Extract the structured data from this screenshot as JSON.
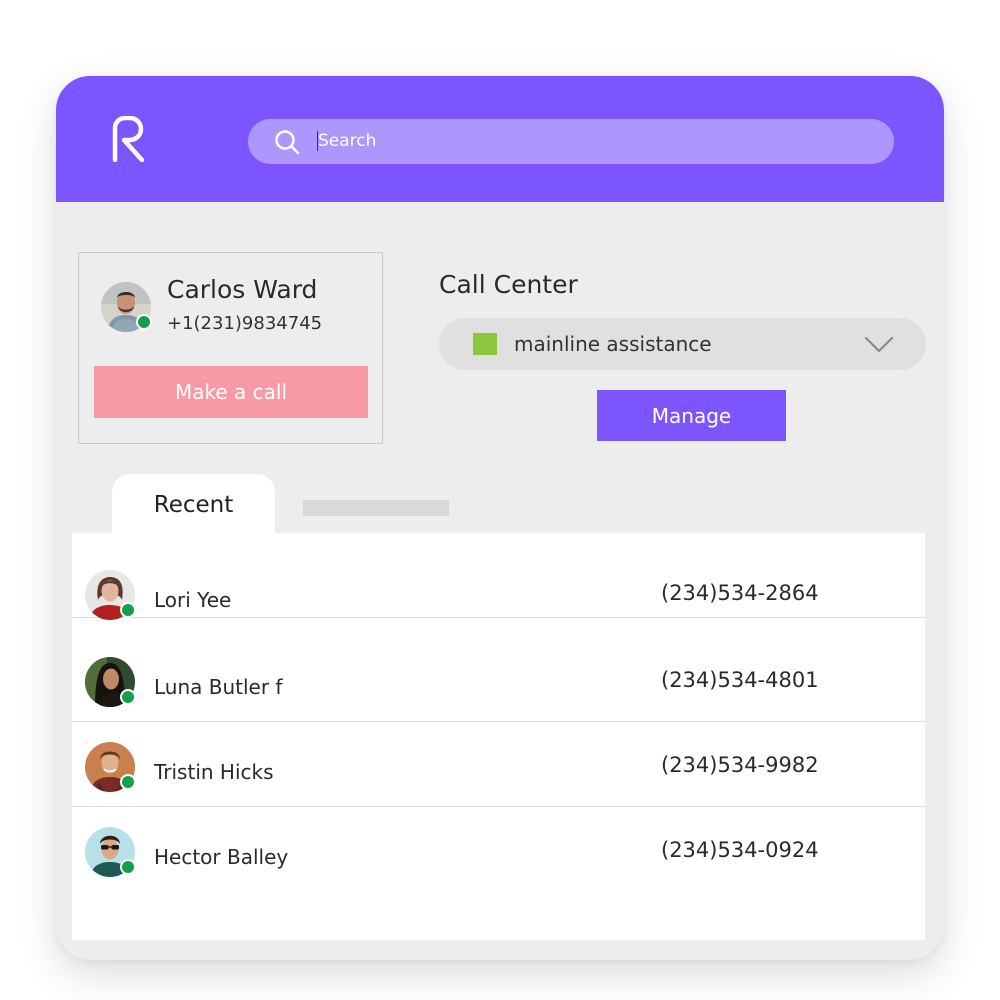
{
  "header": {
    "logo_icon": "r-logo-icon",
    "search": {
      "icon": "search-icon",
      "placeholder": "Search"
    }
  },
  "profile": {
    "name": "Carlos Ward",
    "phone": "+1(231)9834745",
    "status": "online",
    "make_call_label": "Make a call"
  },
  "call_center": {
    "title": "Call Center",
    "selected": "mainline assistance",
    "swatch_color": "#8dc63f",
    "manage_label": "Manage"
  },
  "tabs": {
    "recent_label": "Recent"
  },
  "recent": [
    {
      "name": "Lori Yee",
      "phone": "(234)534-2864",
      "status": "online"
    },
    {
      "name": "Luna Butler f",
      "phone": "(234)534-4801",
      "status": "online"
    },
    {
      "name": "Tristin Hicks",
      "phone": "(234)534-9982",
      "status": "online"
    },
    {
      "name": "Hector Balley",
      "phone": "(234)534-0924",
      "status": "online"
    }
  ],
  "colors": {
    "brand": "#7d55fe",
    "search_bg": "#ab97fe",
    "call_button": "#f89aa6",
    "online": "#13a04a",
    "background": "#eeeded"
  }
}
